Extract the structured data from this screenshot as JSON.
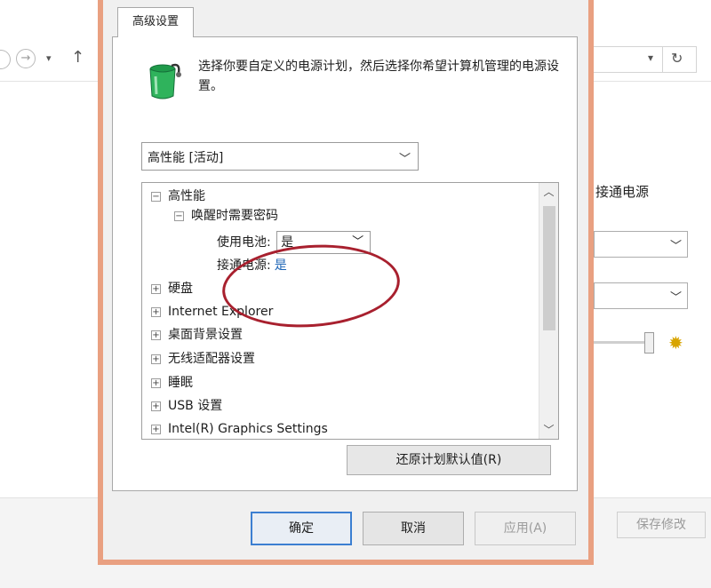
{
  "background_window": {
    "section_label": "接通电源",
    "save_button": "保存修改"
  },
  "dialog": {
    "tab_label": "高级设置",
    "description": "选择你要自定义的电源计划，然后选择你希望计算机管理的电源设置。",
    "plan_select_value": "高性能 [活动]",
    "tree": {
      "root": "高性能",
      "group": "唤醒时需要密码",
      "battery_label": "使用电池:",
      "battery_value": "是",
      "plugged_label": "接通电源:",
      "plugged_value": "是",
      "items": [
        "硬盘",
        "Internet Explorer",
        "桌面背景设置",
        "无线适配器设置",
        "睡眠",
        "USB 设置",
        "Intel(R) Graphics Settings"
      ]
    },
    "restore_button": "还原计划默认值(R)",
    "ok_button": "确定",
    "cancel_button": "取消",
    "apply_button": "应用(A)"
  },
  "colors": {
    "dialog_border": "#e9a081",
    "highlight_ellipse": "#a8202e",
    "link_value": "#1b63b5",
    "primary_button_border": "#3c7fd1"
  },
  "icons": [
    "back-icon",
    "forward-icon",
    "dropdown-icon",
    "up-icon",
    "refresh-icon",
    "battery-plan-icon",
    "brightness-icon"
  ]
}
